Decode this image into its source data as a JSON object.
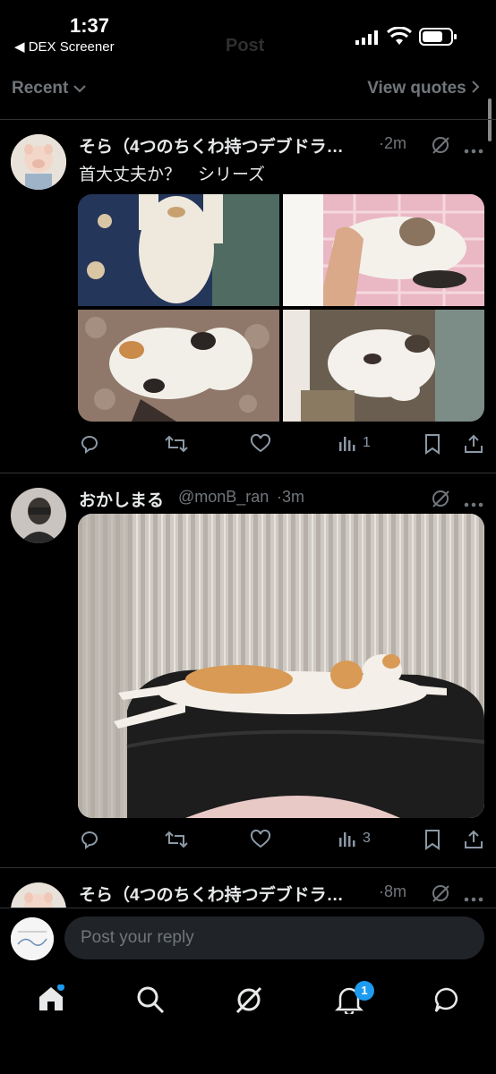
{
  "status_bar": {
    "time": "1:37",
    "back_app": "◀ DEX Screener"
  },
  "header": {
    "ghost_title": "Post"
  },
  "subheader": {
    "filter_label": "Recent",
    "view_quotes": "View quotes"
  },
  "posts": [
    {
      "author": "そら（4つのちくわ持つデブドラ…",
      "time": "·2m",
      "text": "首大丈夫か？　シリーズ",
      "views": "1"
    },
    {
      "author": "おかしまる",
      "handle": "@monB_ran",
      "time": "·3m",
      "views": "3"
    },
    {
      "author": "そら（4つのちくわ持つデブドラ…",
      "time": "·8m"
    }
  ],
  "reply": {
    "placeholder": "Post your reply"
  },
  "bottom_nav": {
    "notifications_badge": "1"
  },
  "colors": {
    "background": "#000000",
    "accent": "#1d9bf0",
    "muted": "#71767b"
  }
}
